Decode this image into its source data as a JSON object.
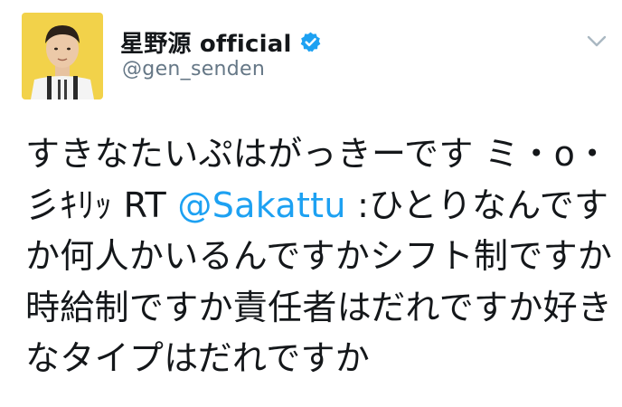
{
  "tweet": {
    "display_name": "星野源 official",
    "handle": "@gen_senden",
    "text_part1": "すきなたいぷはがっきーです ミ・ο・彡ｷﾘｯ RT ",
    "mention": "@Sakattu",
    "text_part2": " :ひとりなんですか何人かいるんですかシフト制ですか時給制ですか責任者はだれですか好きなタイプはだれですか"
  },
  "icons": {
    "verified": "verified-badge-icon",
    "menu": "chevron-down-icon"
  },
  "colors": {
    "text": "#14171a",
    "secondary": "#657786",
    "link": "#1da1f2",
    "verified": "#1da1f2",
    "avatar_bg": "#f2d24a"
  }
}
